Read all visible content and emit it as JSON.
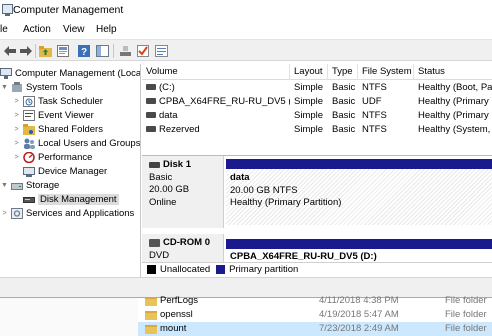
{
  "window": {
    "title": "Computer Management"
  },
  "menu": [
    "le",
    "Action",
    "View",
    "Help"
  ],
  "toolbar": {
    "icons": [
      "back-arrow-icon",
      "forward-arrow-icon",
      "folder-up-icon",
      "properties-icon",
      "help-icon",
      "show-hide-icon",
      "connect-drive-icon",
      "checklist-icon",
      "refresh-view-icon"
    ]
  },
  "tree": {
    "root": "Computer Management (Local",
    "system_tools": "System Tools",
    "task_scheduler": "Task Scheduler",
    "event_viewer": "Event Viewer",
    "shared_folders": "Shared Folders",
    "local_users": "Local Users and Groups",
    "performance": "Performance",
    "device_manager": "Device Manager",
    "storage": "Storage",
    "disk_management": "Disk Management",
    "services": "Services and Applications"
  },
  "volume_list": {
    "columns": [
      "Volume",
      "Layout",
      "Type",
      "File System",
      "Status"
    ],
    "rows": [
      {
        "volume": "(C:)",
        "layout": "Simple",
        "type": "Basic",
        "fs": "NTFS",
        "status": "Healthy (Boot, Pa"
      },
      {
        "volume": "CPBA_X64FRE_RU-RU_DV5 (D:)",
        "layout": "Simple",
        "type": "Basic",
        "fs": "UDF",
        "status": "Healthy (Primary"
      },
      {
        "volume": "data",
        "layout": "Simple",
        "type": "Basic",
        "fs": "NTFS",
        "status": "Healthy (Primary"
      },
      {
        "volume": "Rezerved",
        "layout": "Simple",
        "type": "Basic",
        "fs": "NTFS",
        "status": "Healthy (System, "
      }
    ]
  },
  "disks": {
    "disk1": {
      "name": "Disk 1",
      "type": "Basic",
      "size": "20.00 GB",
      "state": "Online",
      "partition": {
        "name": "data",
        "size_fs": "20.00 GB NTFS",
        "status": "Healthy (Primary Partition)"
      }
    },
    "cdrom0": {
      "name": "CD-ROM 0",
      "type": "DVD",
      "partition": {
        "name": "CPBA_X64FRE_RU-RU_DV5 (D:)"
      }
    }
  },
  "legend": {
    "unallocated": "Unallocated",
    "primary": "Primary partition",
    "unallocated_color": "#000000",
    "primary_color": "#1a1a8e"
  },
  "explorer": {
    "files": [
      {
        "name": "PerfLogs",
        "date": "4/11/2018 4:38 PM",
        "type": "File folder"
      },
      {
        "name": "openssl",
        "date": "4/19/2018 5:47 AM",
        "type": "File folder"
      },
      {
        "name": "mount",
        "date": "7/23/2018 2:49 AM",
        "type": "File folder"
      }
    ]
  }
}
